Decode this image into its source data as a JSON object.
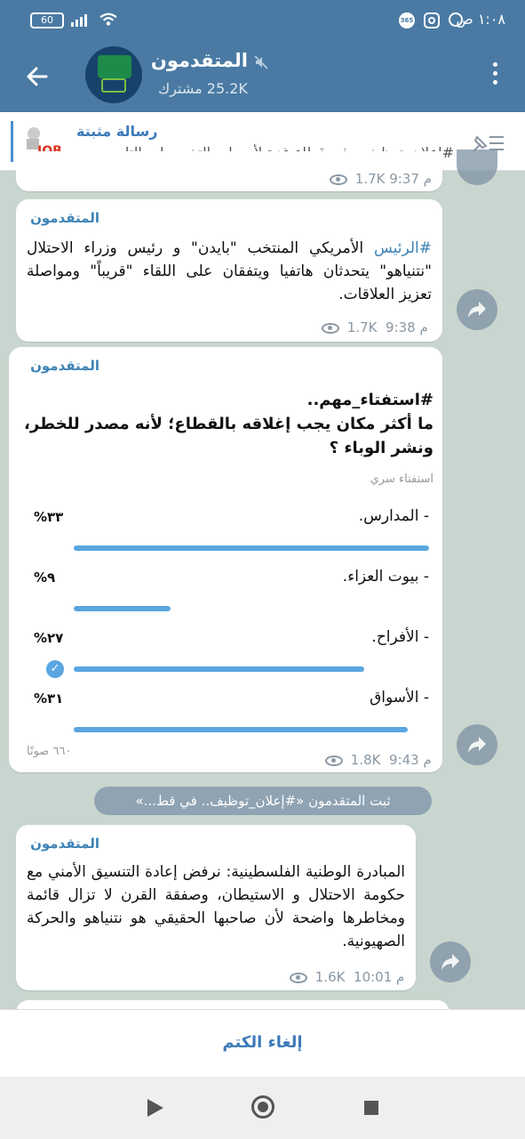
{
  "status_bar": {
    "time": "١:٠٨ ص",
    "battery": "60"
  },
  "header": {
    "title": "المتقدمون",
    "subscribers": "25.2K مشترك"
  },
  "pinned": {
    "label": "رسالة مثبتة",
    "text": "#إعلان_توظيف.. في قطاع غزة لأصحاب التخصصات التا..."
  },
  "messages": [
    {
      "meta_time": "9:37 م",
      "meta_views": "1.7K"
    },
    {
      "author": "المتقدمون",
      "hashtag": "#الرئيس",
      "text": " الأمريكي المنتخب \"بايدن\" و رئيس وزراء الاحتلال \"نتنياهو\" يتحدثان هاتفيا ويتفقان على اللقاء \"قريباً\" ومواصلة تعزيز العلاقات.",
      "time": "9:38 م",
      "views": "1.7K"
    },
    {
      "author": "المتقدمون",
      "question": "#استفتاء_مهم..\nما أكثر مكان يجب إغلاقه بالقطاع؛ لأنه مصدر للخطر، ونشر الوباء ؟",
      "poll_type": "استفتاء سري",
      "options": [
        {
          "label": "- المدارس.",
          "percent": "٣٣%",
          "value": 33,
          "voted": false
        },
        {
          "label": "- بيوت العزاء.",
          "percent": "٩%",
          "value": 9,
          "voted": false
        },
        {
          "label": "- الأفراح.",
          "percent": "٢٧%",
          "value": 27,
          "voted": true
        },
        {
          "label": "- الأسواق",
          "percent": "٣١%",
          "value": 31,
          "voted": false
        }
      ],
      "votes": "٦٦٠ صوتًا",
      "time": "9:43 م",
      "views": "1.8K"
    },
    {
      "author": "المتقدمون",
      "text": "المبادرة الوطنية الفلسطينية: نرفض إعادة التنسيق الأمني مع حكومة الاحتلال و الاستيطان، وصفقة القرن لا تزال قائمة ومخاطرها واضحة لأن صاحبها الحقيقي هو نتنياهو والحركة الصهيونية.",
      "time": "10:01 م",
      "views": "1.6K"
    }
  ],
  "service_message": "ثبت المتقدمون «#إعلان_توظيف.. في قط...»",
  "unmute_label": "إلغاء الكتم",
  "colors": {
    "header": "#4a7aa3",
    "accent": "#3d83b5",
    "poll_bar": "#5aa6e0",
    "background": "#c9d6cf"
  }
}
